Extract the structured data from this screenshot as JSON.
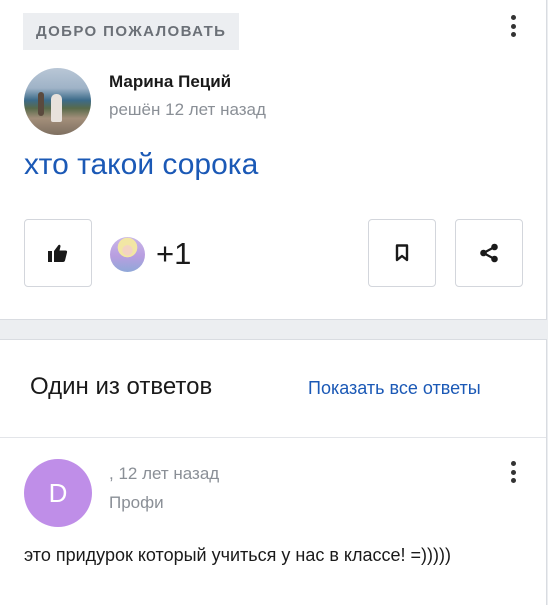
{
  "question": {
    "badge": "Добро пожаловать",
    "author_name": "Марина Пеций",
    "status": "решён 12 лет назад",
    "title": "хто такой сорока",
    "likes_extra": "+1"
  },
  "answers": {
    "heading": "Один из ответов",
    "show_all_label": "Показать все ответы",
    "items": [
      {
        "avatar_letter": "D",
        "meta": ", 12 лет назад",
        "rank": "Профи",
        "text": "это придурок который учиться у нас в классе! =)))))"
      }
    ]
  },
  "colors": {
    "link": "#1b59b6",
    "badge_bg": "#eceef1",
    "answer_avatar": "#bf8ee8"
  },
  "icons": {
    "like": "thumbs-up-icon",
    "bookmark": "bookmark-icon",
    "share": "share-icon",
    "menu": "more-vertical-icon"
  }
}
